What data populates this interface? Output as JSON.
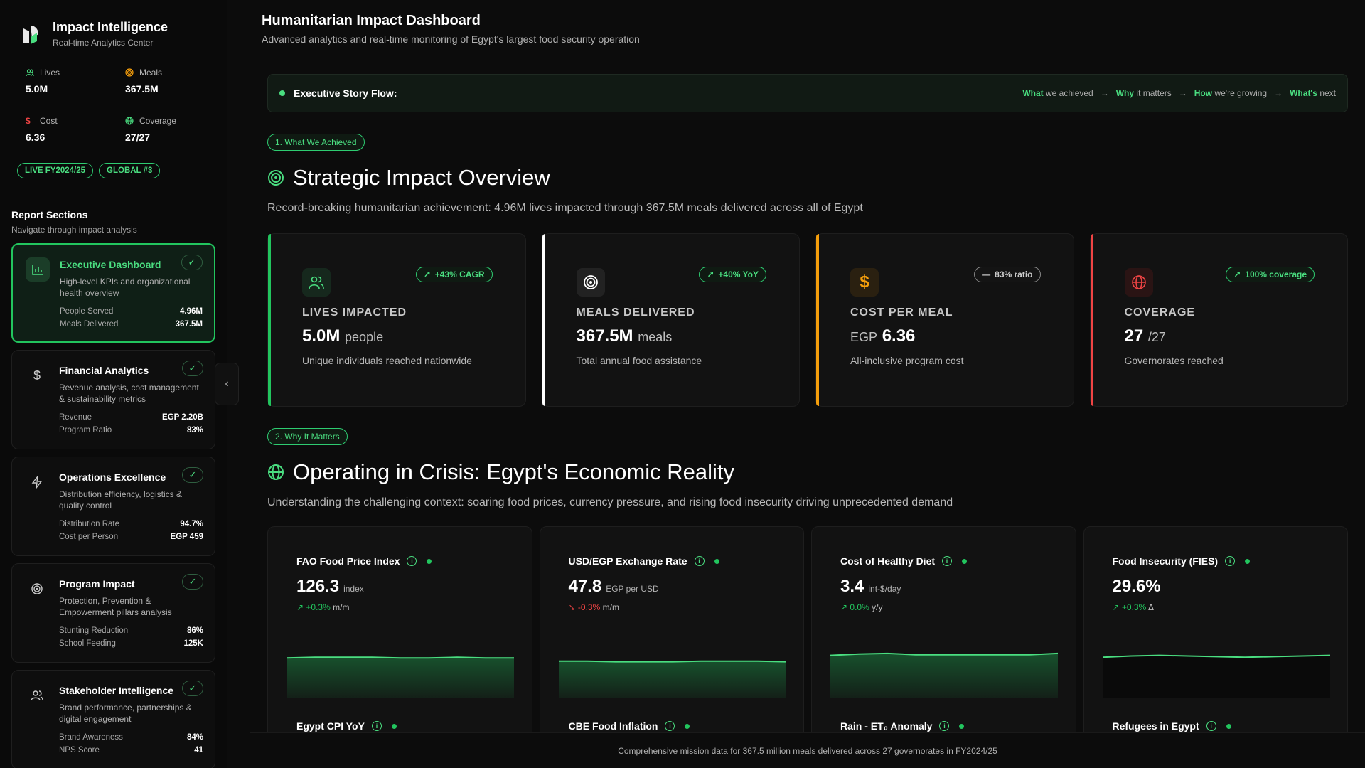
{
  "brand": {
    "title": "Impact Intelligence",
    "subtitle": "Real-time Analytics Center"
  },
  "sidebar_stats": [
    {
      "label": "Lives",
      "value": "5.0M",
      "icon": "users-icon",
      "color": "#4ade80"
    },
    {
      "label": "Meals",
      "value": "367.5M",
      "icon": "target-icon",
      "color": "#f59e0b"
    },
    {
      "label": "Cost",
      "value": "6.36",
      "icon": "dollar-icon",
      "color": "#ef4444"
    },
    {
      "label": "Coverage",
      "value": "27/27",
      "icon": "globe-icon",
      "color": "#4ade80"
    }
  ],
  "badges": [
    "LIVE FY2024/25",
    "GLOBAL #3"
  ],
  "sections": {
    "title": "Report Sections",
    "subtitle": "Navigate through impact analysis",
    "items": [
      {
        "title": "Executive Dashboard",
        "desc": "High-level KPIs and organizational health overview",
        "icon": "bar-chart-icon",
        "metrics": [
          {
            "label": "People Served",
            "value": "4.96M"
          },
          {
            "label": "Meals Delivered",
            "value": "367.5M"
          }
        ]
      },
      {
        "title": "Financial Analytics",
        "desc": "Revenue analysis, cost management & sustainability metrics",
        "icon": "dollar-icon",
        "metrics": [
          {
            "label": "Revenue",
            "value": "EGP 2.20B"
          },
          {
            "label": "Program Ratio",
            "value": "83%"
          }
        ]
      },
      {
        "title": "Operations Excellence",
        "desc": "Distribution efficiency, logistics & quality control",
        "icon": "bolt-icon",
        "metrics": [
          {
            "label": "Distribution Rate",
            "value": "94.7%"
          },
          {
            "label": "Cost per Person",
            "value": "EGP 459"
          }
        ]
      },
      {
        "title": "Program Impact",
        "desc": "Protection, Prevention & Empowerment pillars analysis",
        "icon": "target-icon",
        "metrics": [
          {
            "label": "Stunting Reduction",
            "value": "86%"
          },
          {
            "label": "School Feeding",
            "value": "125K"
          }
        ]
      },
      {
        "title": "Stakeholder Intelligence",
        "desc": "Brand performance, partnerships & digital engagement",
        "icon": "users-icon",
        "metrics": [
          {
            "label": "Brand Awareness",
            "value": "84%"
          },
          {
            "label": "NPS Score",
            "value": "41"
          }
        ]
      }
    ]
  },
  "header": {
    "title": "Humanitarian Impact Dashboard",
    "subtitle": "Advanced analytics and real-time monitoring of Egypt's largest food security operation"
  },
  "story": {
    "label": "Executive Story Flow:",
    "steps": [
      {
        "key": "What",
        "rest": "we achieved"
      },
      {
        "key": "Why",
        "rest": "it matters"
      },
      {
        "key": "How",
        "rest": "we're growing"
      },
      {
        "key": "What's",
        "rest": "next"
      }
    ],
    "arrow": "→"
  },
  "section1": {
    "badge": "1. What We Achieved",
    "title": "Strategic Impact Overview",
    "desc": "Record-breaking humanitarian achievement: 4.96M lives impacted through 367.5M meals delivered across all of Egypt"
  },
  "kpis": [
    {
      "label": "LIVES IMPACTED",
      "prefix": "",
      "value": "5.0M",
      "unit": "people",
      "note": "Unique individuals reached nationwide",
      "pill": "+43% CAGR",
      "accent": "#22c55e",
      "icon": "users-icon",
      "icon_bg": "#16281d",
      "icon_color": "#4ade80"
    },
    {
      "label": "MEALS DELIVERED",
      "prefix": "",
      "value": "367.5M",
      "unit": "meals",
      "note": "Total annual food assistance",
      "pill": "+40% YoY",
      "accent": "#ffffff",
      "icon": "target-icon",
      "icon_bg": "#222222",
      "icon_color": "#ffffff"
    },
    {
      "label": "COST PER MEAL",
      "prefix": "EGP",
      "value": "6.36",
      "unit": "",
      "note": "All-inclusive program cost",
      "pill": "83% ratio",
      "accent": "#f59e0b",
      "icon": "dollar-icon",
      "icon_bg": "#2a2010",
      "icon_color": "#f59e0b"
    },
    {
      "label": "COVERAGE",
      "prefix": "",
      "value": "27",
      "unit": "/27",
      "note": "Governorates reached",
      "pill": "100% coverage",
      "accent": "#ef4444",
      "icon": "globe-icon",
      "icon_bg": "#2a1414",
      "icon_color": "#ef4444"
    }
  ],
  "section2": {
    "badge": "2. Why It Matters",
    "title": "Operating in Crisis: Egypt's Economic Reality",
    "desc": "Understanding the challenging context: soaring food prices, currency pressure, and rising food insecurity driving unprecedented demand"
  },
  "indicators": [
    {
      "title": "FAO Food Price Index",
      "value": "126.3",
      "unit": "index",
      "change": "+0.3%",
      "change_unit": "m/m",
      "direction": "up",
      "next": "Egypt CPI YoY"
    },
    {
      "title": "USD/EGP Exchange Rate",
      "value": "47.8",
      "unit": "EGP per USD",
      "change": "-0.3%",
      "change_unit": "m/m",
      "direction": "down",
      "next": "CBE Food Inflation"
    },
    {
      "title": "Cost of Healthy Diet",
      "value": "3.4",
      "unit": "int-$/day",
      "change": "0.0%",
      "change_unit": "y/y",
      "direction": "up",
      "next": "Rain - ET₀ Anomaly"
    },
    {
      "title": "Food Insecurity (FIES)",
      "value": "29.6%",
      "unit": "",
      "change": "+0.3%",
      "change_unit": "Δ",
      "direction": "up",
      "next": "Refugees in Egypt"
    }
  ],
  "chart_data": [
    {
      "type": "area",
      "name": "",
      "values": [
        0.62,
        0.63,
        0.63,
        0.63,
        0.62,
        0.62,
        0.63,
        0.62,
        0.62
      ]
    },
    {
      "type": "area",
      "name": "",
      "values": [
        0.57,
        0.57,
        0.56,
        0.56,
        0.56,
        0.57,
        0.57,
        0.57,
        0.56
      ]
    },
    {
      "type": "area",
      "name": "",
      "values": [
        0.66,
        0.68,
        0.69,
        0.67,
        0.67,
        0.67,
        0.67,
        0.67,
        0.69
      ]
    },
    {
      "type": "area",
      "name": "",
      "values": [
        0.63,
        0.65,
        0.66,
        0.65,
        0.64,
        0.63,
        0.64,
        0.65,
        0.66
      ]
    }
  ],
  "footer": "Comprehensive mission data for 367.5 million meals delivered across 27 governorates in FY2024/25",
  "colors": {
    "accent": "#22c55e",
    "negative": "#ef4444",
    "warning": "#f59e0b"
  }
}
